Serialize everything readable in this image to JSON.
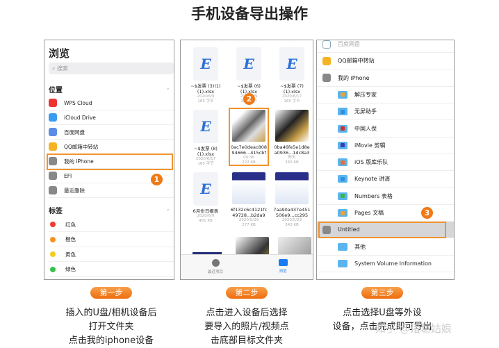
{
  "title": "手机设备导出操作",
  "panel1": {
    "header": "浏览",
    "search_placeholder": "搜索",
    "locations_label": "位置",
    "locations": [
      {
        "label": "WPS Cloud",
        "icon": "wps-icon",
        "color": "#e33"
      },
      {
        "label": "iCloud Drive",
        "icon": "cloud-icon",
        "color": "#3a9cf0"
      },
      {
        "label": "百度网盘",
        "icon": "baidu-icon",
        "color": "#5b8de8"
      },
      {
        "label": "QQ邮箱中转站",
        "icon": "mail-icon",
        "color": "#f5b324"
      },
      {
        "label": "我的 iPhone",
        "icon": "phone-icon",
        "color": "#888"
      },
      {
        "label": "EFI",
        "icon": "usb-icon",
        "color": "#888"
      },
      {
        "label": "最近删除",
        "icon": "trash-icon",
        "color": "#888"
      }
    ],
    "tags_label": "标签",
    "tags": [
      {
        "label": "红色",
        "color": "#f03a2e"
      },
      {
        "label": "橙色",
        "color": "#f5921e"
      },
      {
        "label": "黄色",
        "color": "#f7cb1b"
      },
      {
        "label": "绿色",
        "color": "#36c24c"
      }
    ],
    "badge": "1"
  },
  "panel2": {
    "files": [
      {
        "name": "~$发票 (3)(1)(1).xlsx",
        "date": "2020/6/9",
        "size": "165 字节",
        "type": "excel"
      },
      {
        "name": "~$发票 (6)(1).xlsx",
        "date": "2020/6/9",
        "size": "165 字节",
        "type": "excel"
      },
      {
        "name": "~$发票 (7)(1).xlsx",
        "date": "2020/6/17",
        "size": "165 字节",
        "type": "excel"
      },
      {
        "name": "~$发票 (8)(1).xlsx",
        "date": "2020/6/17",
        "size": "165 字节",
        "type": "excel"
      },
      {
        "name": "0ac7e0deac808 94666...415cbf",
        "date": "09:36",
        "size": "222 KB",
        "type": "image"
      },
      {
        "name": "0ba46fe5e1d8e a0936...1dc8a3",
        "date": "昨天",
        "size": "360 KB",
        "type": "image"
      },
      {
        "name": "6月份日报表",
        "date": "2020/6/9",
        "size": "481 KB",
        "type": "excel"
      },
      {
        "name": "6f132c6c4121fc 49728...b2da9",
        "date": "2020/5/29",
        "size": "277 KB",
        "type": "image"
      },
      {
        "name": "7aa90a437e451 506e9...cc295",
        "date": "2020/5/29",
        "size": "343 KB",
        "type": "image"
      }
    ],
    "tabs": [
      {
        "label": "最近项目",
        "icon": "clock-icon"
      },
      {
        "label": "浏览",
        "icon": "folder-icon",
        "active": true
      }
    ],
    "badge": "2",
    "accent": "#1a7cf0"
  },
  "panel3": {
    "items": [
      {
        "label": "百度网盘",
        "level": 0
      },
      {
        "label": "QQ邮箱中转站",
        "level": 0
      },
      {
        "label": "我的 iPhone",
        "level": 0
      },
      {
        "label": "解压专家",
        "level": 1,
        "color": "#e6a23c"
      },
      {
        "label": "无屏助手",
        "level": 1,
        "color": "#2f8fe0"
      },
      {
        "label": "中国人保",
        "level": 1,
        "color": "#d0302a"
      },
      {
        "label": "iMovie 剪辑",
        "level": 1,
        "color": "#3a3ab0"
      },
      {
        "label": "iOS 版库乐队",
        "level": 1,
        "color": "#e0703a"
      },
      {
        "label": "Keynote 讲演",
        "level": 1,
        "color": "#2f8fe0"
      },
      {
        "label": "Numbers 表格",
        "level": 1,
        "color": "#3bb54a"
      },
      {
        "label": "Pages 文稿",
        "level": 1,
        "color": "#f0a030"
      },
      {
        "label": "Untitled",
        "level": 0,
        "selected": true
      },
      {
        "label": "其他",
        "level": 1
      },
      {
        "label": "System Volume Information",
        "level": 1
      }
    ],
    "badge": "3"
  },
  "steps": [
    {
      "label": "第一步",
      "lines": [
        "插入的U盘/相机设备后",
        "打开文件夹",
        "点击我的iphone设备"
      ]
    },
    {
      "label": "第二步",
      "lines": [
        "点击进入设备后选择",
        "要导入的照片/视频点",
        "击底部目标文件夹"
      ]
    },
    {
      "label": "第三步",
      "lines": [
        "点击选择U盘等外设",
        "设备，点击完成即可导出"
      ]
    }
  ],
  "watermark": "知乎 @诸葛姑娘"
}
